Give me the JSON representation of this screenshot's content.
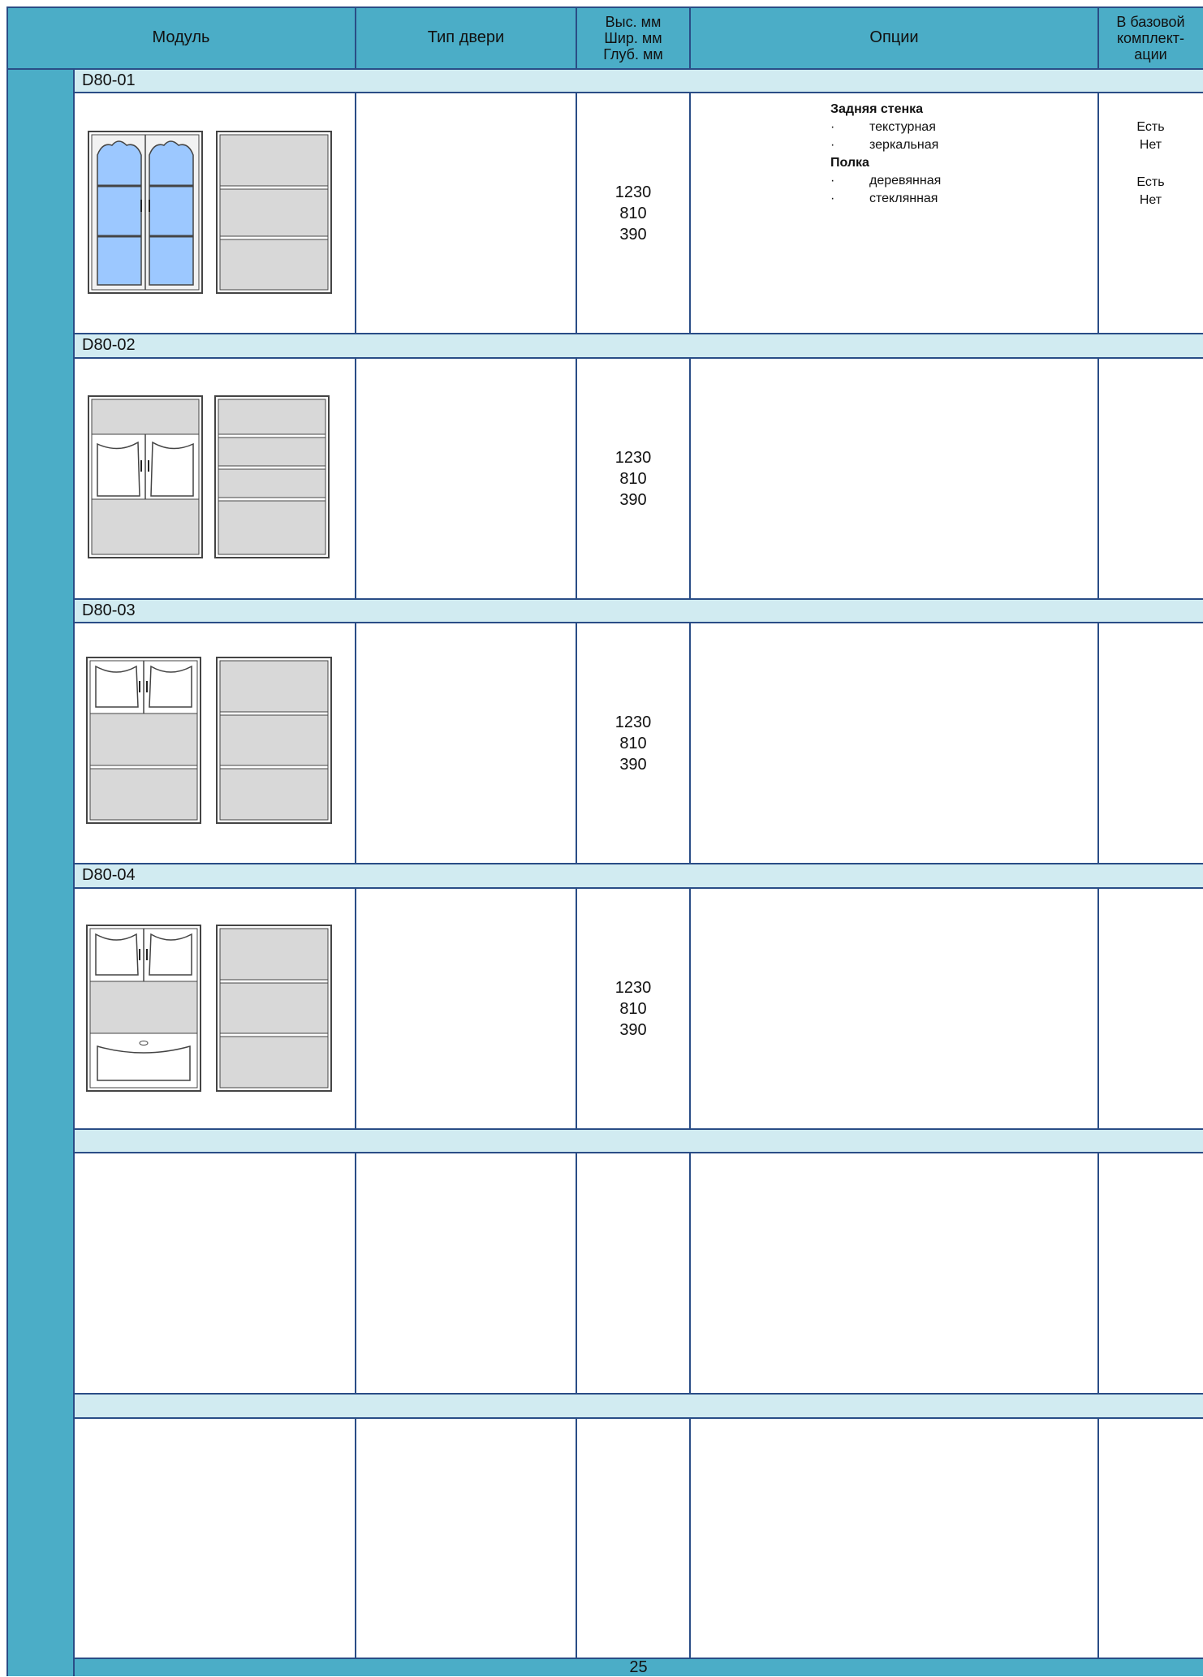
{
  "header": {
    "module": "Модуль",
    "door_type": "Тип двери",
    "dims": [
      "Выс. мм",
      "Шир. мм",
      "Глуб. мм"
    ],
    "options": "Опции",
    "base": [
      "В базовой",
      "комплект-",
      "ации"
    ]
  },
  "rows": [
    {
      "code": "D80-01",
      "dims": [
        "1230",
        "810",
        "390"
      ],
      "options": {
        "groups": [
          {
            "title": "Задняя стенка",
            "items": [
              "текстурная",
              "зеркальная"
            ],
            "base": [
              "Есть",
              "Нет"
            ]
          },
          {
            "title": "Полка",
            "items": [
              "деревянная",
              "стеклянная"
            ],
            "base": [
              "Есть",
              "Нет"
            ]
          }
        ],
        "bullet": "·"
      }
    },
    {
      "code": "D80-02",
      "dims": [
        "1230",
        "810",
        "390"
      ]
    },
    {
      "code": "D80-03",
      "dims": [
        "1230",
        "810",
        "390"
      ]
    },
    {
      "code": "D80-04",
      "dims": [
        "1230",
        "810",
        "390"
      ]
    },
    {
      "code": "",
      "dims": [
        "",
        "",
        ""
      ]
    },
    {
      "code": "",
      "dims": [
        "",
        "",
        ""
      ]
    }
  ],
  "footer": {
    "page_number": "25"
  },
  "colors": {
    "header_bg": "#4badc7",
    "band_bg": "#d1ebf1",
    "grid_line": "#2a4d86",
    "glass": "#9cc8ff",
    "panel": "#d8d8d8"
  },
  "icons": [
    "cabinet-front-icon",
    "cabinet-interior-icon"
  ]
}
